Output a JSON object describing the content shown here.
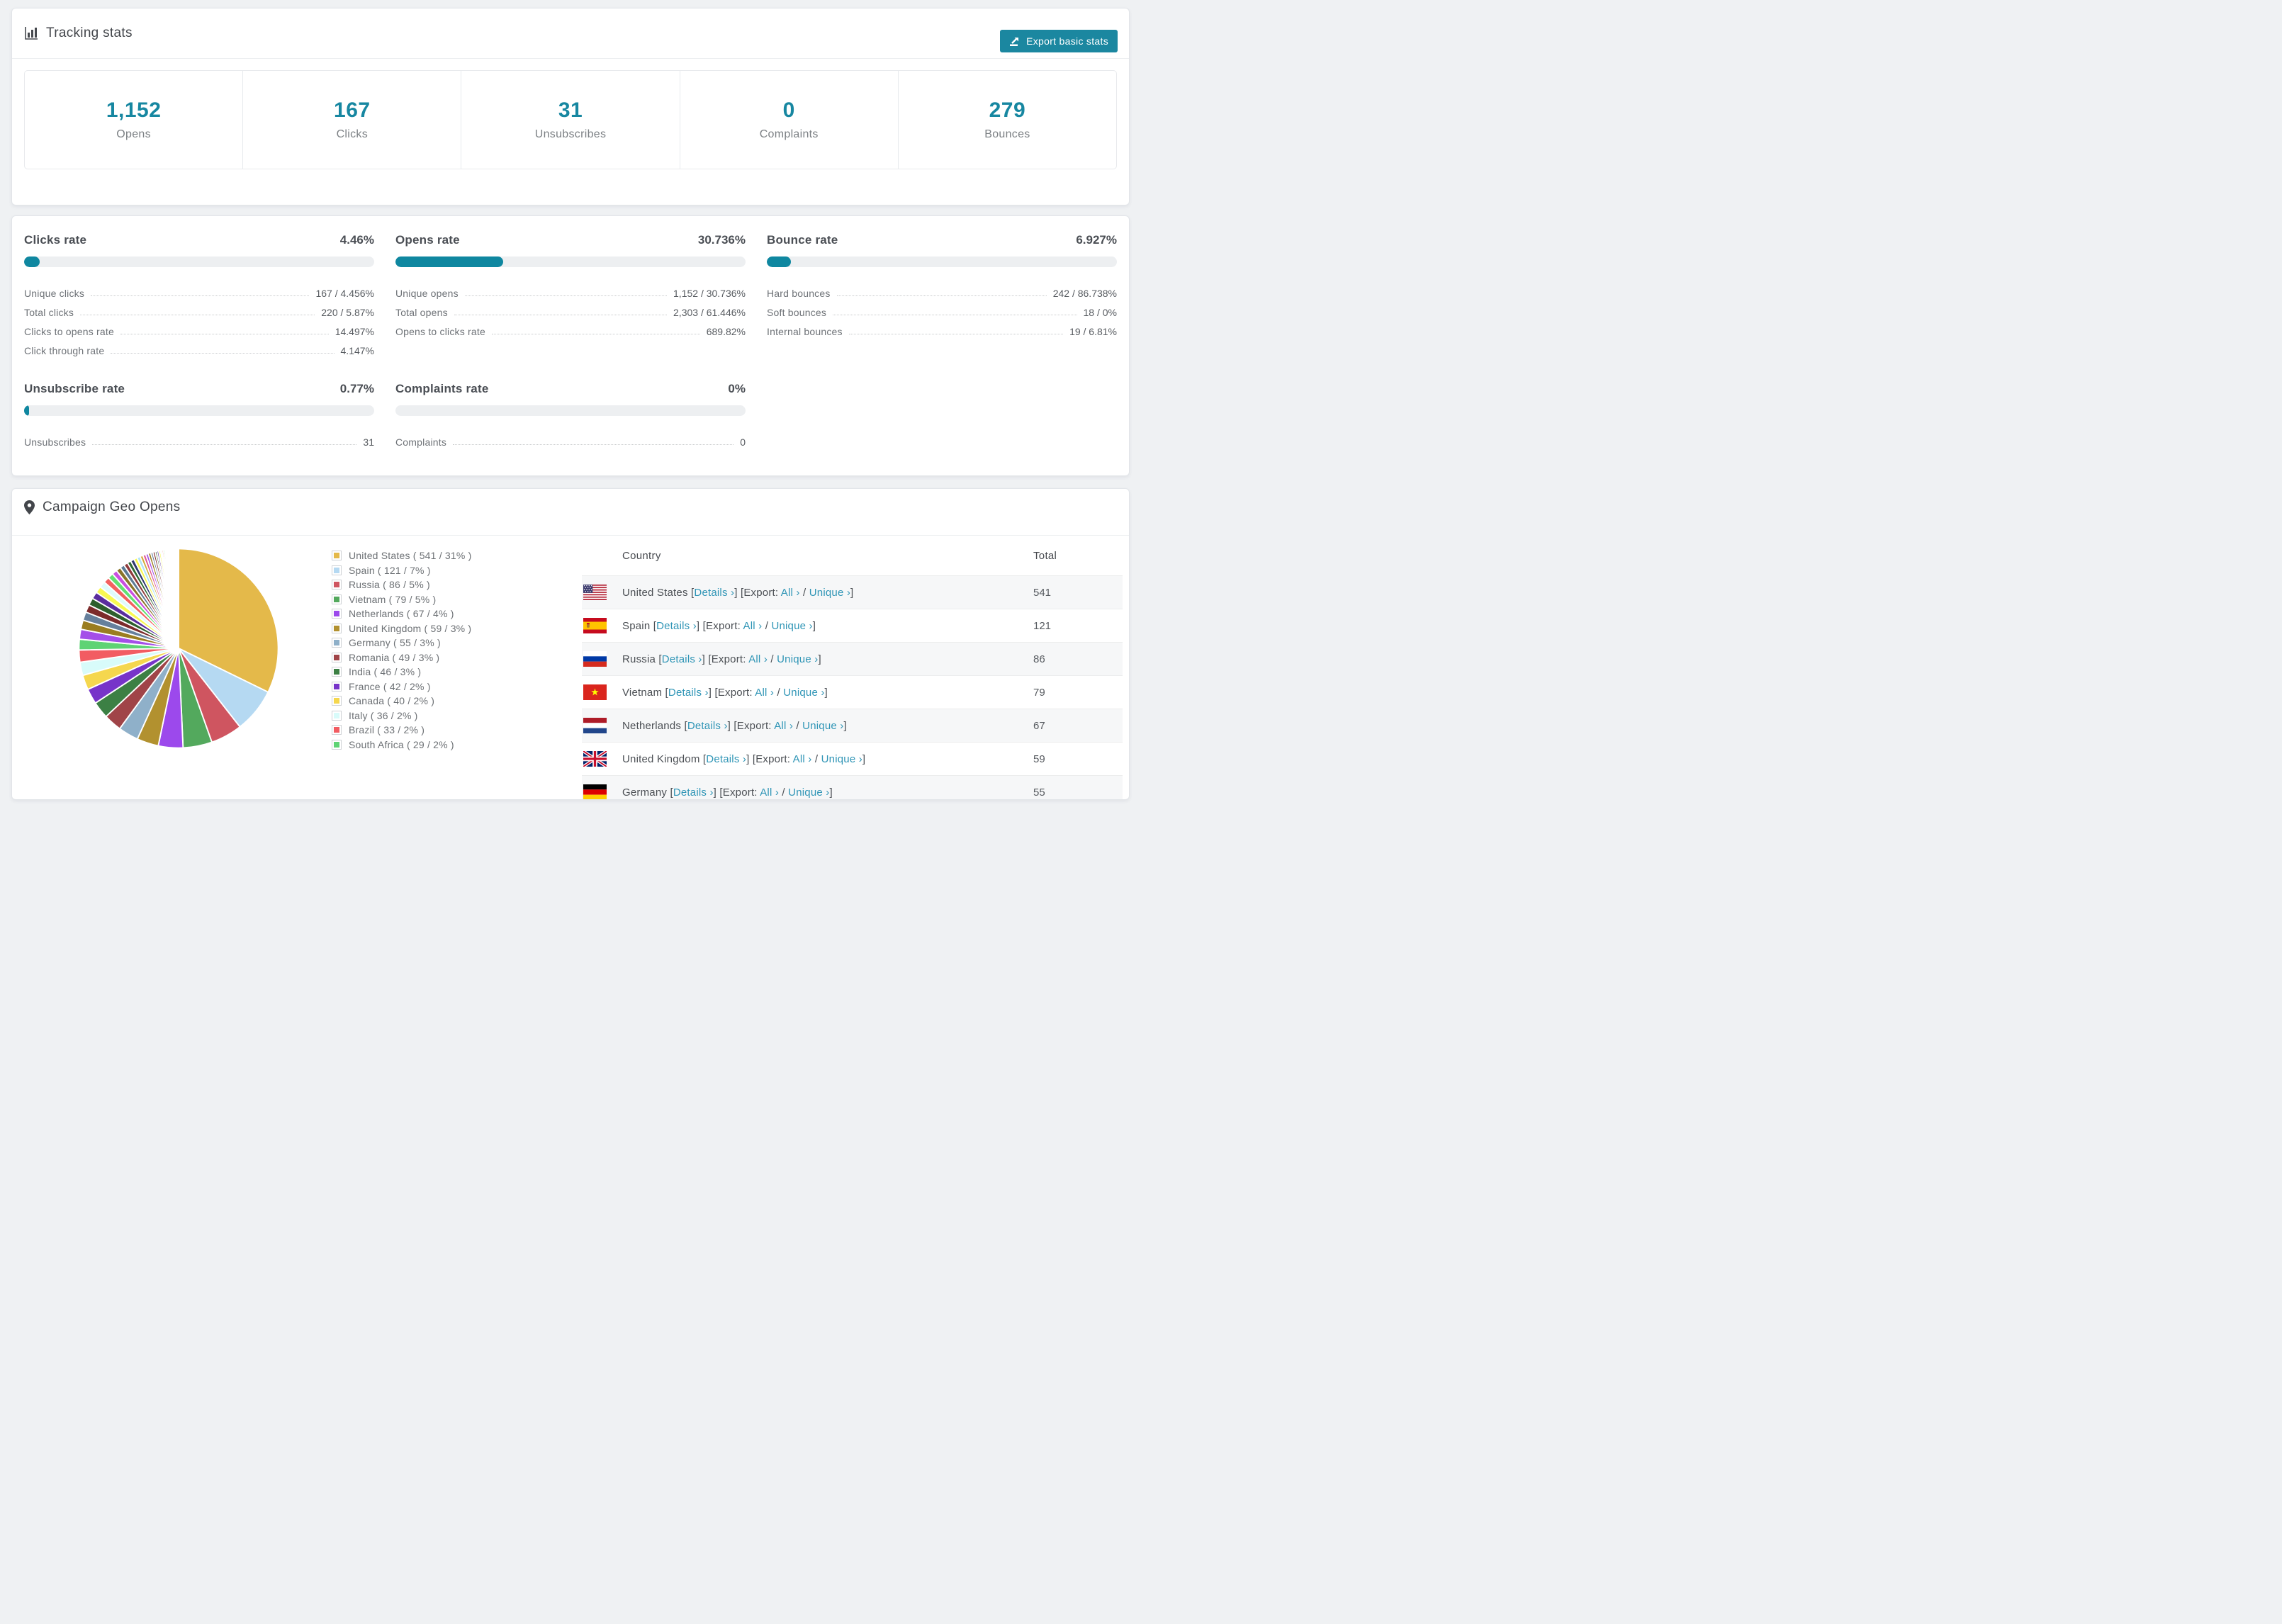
{
  "tracking": {
    "title": "Tracking stats",
    "export_button": "Export basic stats",
    "stats": [
      {
        "value": "1,152",
        "label": "Opens"
      },
      {
        "value": "167",
        "label": "Clicks"
      },
      {
        "value": "31",
        "label": "Unsubscribes"
      },
      {
        "value": "0",
        "label": "Complaints"
      },
      {
        "value": "279",
        "label": "Bounces"
      }
    ]
  },
  "rates": {
    "clicks": {
      "title": "Clicks rate",
      "value": "4.46%",
      "percent": 4.46,
      "rows": [
        {
          "label": "Unique clicks",
          "value": "167 / 4.456%"
        },
        {
          "label": "Total clicks",
          "value": "220 / 5.87%"
        },
        {
          "label": "Clicks to opens rate",
          "value": "14.497%"
        },
        {
          "label": "Click through rate",
          "value": "4.147%"
        }
      ]
    },
    "opens": {
      "title": "Opens rate",
      "value": "30.736%",
      "percent": 30.736,
      "rows": [
        {
          "label": "Unique opens",
          "value": "1,152 / 30.736%"
        },
        {
          "label": "Total opens",
          "value": "2,303 / 61.446%"
        },
        {
          "label": "Opens to clicks rate",
          "value": "689.82%"
        }
      ]
    },
    "bounce": {
      "title": "Bounce rate",
      "value": "6.927%",
      "percent": 6.927,
      "rows": [
        {
          "label": "Hard bounces",
          "value": "242 / 86.738%"
        },
        {
          "label": "Soft bounces",
          "value": "18 / 0%"
        },
        {
          "label": "Internal bounces",
          "value": "19 / 6.81%"
        }
      ]
    },
    "unsubscribe": {
      "title": "Unsubscribe rate",
      "value": "0.77%",
      "percent": 0.77,
      "rows": [
        {
          "label": "Unsubscribes",
          "value": "31"
        }
      ]
    },
    "complaints": {
      "title": "Complaints rate",
      "value": "0%",
      "percent": 0,
      "rows": [
        {
          "label": "Complaints",
          "value": "0"
        }
      ]
    }
  },
  "geo": {
    "title": "Campaign Geo Opens",
    "table": {
      "headers": [
        "Country",
        "Total"
      ],
      "links": {
        "open": "[",
        "close": "]",
        "details": "Details ›",
        "export": "[Export:",
        "all": "All ›",
        "slash": "/",
        "unique": "Unique ›"
      },
      "rows": [
        {
          "country": "United States",
          "flag": "us",
          "total": "541"
        },
        {
          "country": "Spain",
          "flag": "es",
          "total": "121"
        },
        {
          "country": "Russia",
          "flag": "ru",
          "total": "86"
        },
        {
          "country": "Vietnam",
          "flag": "vn",
          "total": "79"
        },
        {
          "country": "Netherlands",
          "flag": "nl",
          "total": "67"
        },
        {
          "country": "United Kingdom",
          "flag": "gb",
          "total": "59"
        },
        {
          "country": "Germany",
          "flag": "de",
          "total": "55"
        }
      ]
    }
  },
  "chart_data": {
    "type": "pie",
    "title": "Campaign Geo Opens",
    "legend_position": "right",
    "start_angle_deg": -90,
    "direction": "clockwise",
    "slices": [
      {
        "label": "United States",
        "value": 541,
        "pct_label": "31%",
        "color": "#e4b94a",
        "legend_label": "United States ( 541 / 31% )"
      },
      {
        "label": "Spain",
        "value": 121,
        "pct_label": "7%",
        "color": "#b5d9f2",
        "legend_label": "Spain ( 121 / 7% )"
      },
      {
        "label": "Russia",
        "value": 86,
        "pct_label": "5%",
        "color": "#cf5560",
        "legend_label": "Russia ( 86 / 5% )"
      },
      {
        "label": "Vietnam",
        "value": 79,
        "pct_label": "5%",
        "color": "#53a95d",
        "legend_label": "Vietnam ( 79 / 5% )"
      },
      {
        "label": "Netherlands",
        "value": 67,
        "pct_label": "4%",
        "color": "#9c49ec",
        "legend_label": "Netherlands ( 67 / 4% )"
      },
      {
        "label": "United Kingdom",
        "value": 59,
        "pct_label": "3%",
        "color": "#b2912f",
        "legend_label": "United Kingdom ( 59 / 3% )"
      },
      {
        "label": "Germany",
        "value": 55,
        "pct_label": "3%",
        "color": "#8fb0c9",
        "legend_label": "Germany ( 55 / 3% )"
      },
      {
        "label": "Romania",
        "value": 49,
        "pct_label": "3%",
        "color": "#a04448",
        "legend_label": "Romania ( 49 / 3% )"
      },
      {
        "label": "India",
        "value": 46,
        "pct_label": "3%",
        "color": "#3c8044",
        "legend_label": "India ( 46 / 3% )"
      },
      {
        "label": "France",
        "value": 42,
        "pct_label": "2%",
        "color": "#7734c9",
        "legend_label": "France ( 42 / 2% )"
      },
      {
        "label": "Canada",
        "value": 40,
        "pct_label": "2%",
        "color": "#f5d74e",
        "legend_label": "Canada ( 40 / 2% )"
      },
      {
        "label": "Italy",
        "value": 36,
        "pct_label": "2%",
        "color": "#d8fbfa",
        "legend_label": "Italy ( 36 / 2% )"
      },
      {
        "label": "Brazil",
        "value": 33,
        "pct_label": "2%",
        "color": "#f25c62",
        "legend_label": "Brazil ( 33 / 2% )"
      },
      {
        "label": "South Africa",
        "value": 29,
        "pct_label": "2%",
        "color": "#5ed374",
        "legend_label": "South Africa ( 29 / 2% )"
      }
    ],
    "others": {
      "note": "remaining small unlabeled country slices, sizes estimated from pixels",
      "values": [
        27,
        25,
        23,
        21,
        20,
        19,
        18,
        17,
        16,
        15,
        14,
        13,
        12,
        11,
        10,
        10,
        9,
        9,
        8,
        8,
        7,
        7,
        6,
        6,
        5,
        5,
        5,
        4,
        4,
        4,
        3,
        3,
        3,
        3,
        2,
        2,
        2,
        2,
        2,
        1,
        1,
        1,
        1,
        1,
        1,
        1,
        1,
        1,
        1,
        1,
        1,
        1,
        1,
        1
      ],
      "palette": [
        "#a44fe8",
        "#9a7d20",
        "#66809c",
        "#7c2b2b",
        "#2d5f2d",
        "#5a2d9e",
        "#f8f852",
        "#dffbfb",
        "#f2615f",
        "#62e072",
        "#c94fe0",
        "#8a742a",
        "#5c7b94",
        "#8e3a3a",
        "#2e6b34",
        "#303a6e",
        "#f7f74e",
        "#aee3f7",
        "#d4a93a",
        "#e05a95"
      ]
    }
  },
  "colors": {
    "accent_teal": "#1b87a0",
    "link_teal": "#2f95b6",
    "bar_bg": "#edeff1",
    "page_bg": "#eff1f3"
  }
}
